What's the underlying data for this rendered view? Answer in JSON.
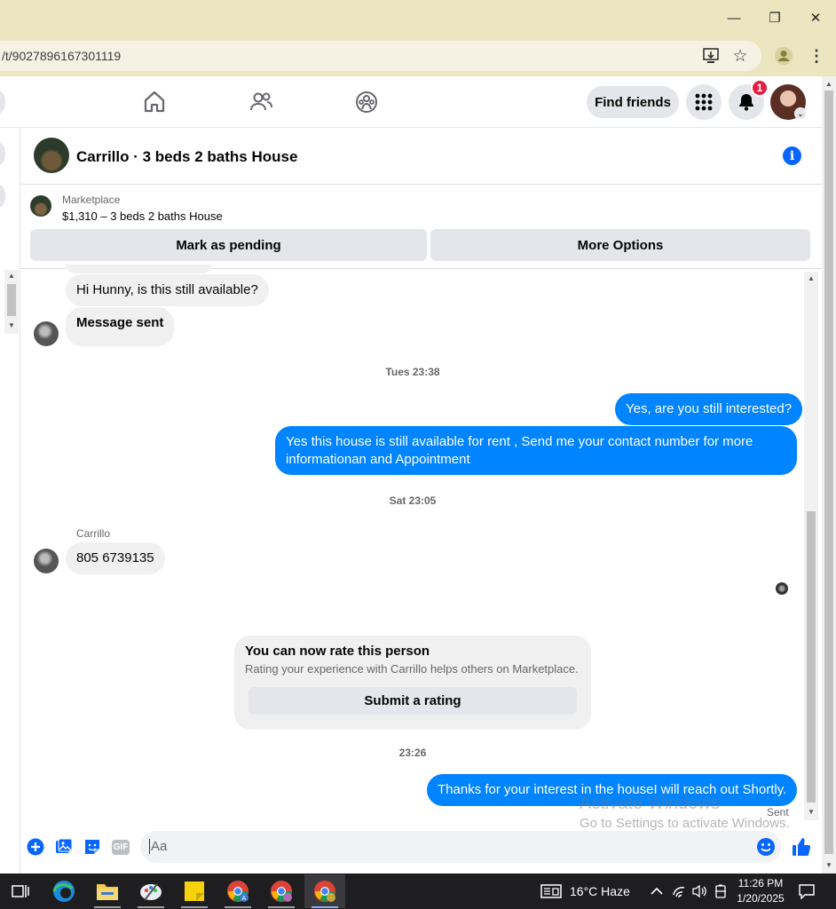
{
  "browser": {
    "url": "/t/9027896167301119",
    "minimize": "—",
    "restore": "❐",
    "close": "✕"
  },
  "header": {
    "find_friends": "Find friends",
    "notification_count": "1"
  },
  "chat": {
    "title": "Carrillo · 3 beds 2 baths House",
    "info": "i",
    "marketplace_label": "Marketplace",
    "listing": "$1,310 – 3 beds 2 baths House",
    "mark_pending": "Mark as pending",
    "more_options": "More Options"
  },
  "messages": {
    "m1": "Hi Hunny, is this still available?",
    "m2": "Message sent",
    "ts1": "Tues 23:38",
    "m3": "Yes, are you still interested?",
    "m4": "Yes this house is still available for rent , Send me your contact number for more informationan and Appointment",
    "ts2": "Sat 23:05",
    "sender": "Carrillo",
    "m5": "805 6739135",
    "ts3": "23:26",
    "m6": "Thanks for your interest in the houseI will reach out Shortly.",
    "status": "Sent"
  },
  "rating": {
    "title": "You can now rate this person",
    "subtitle": "Rating your experience with Carrillo helps others on Marketplace.",
    "button": "Submit a rating"
  },
  "composer": {
    "placeholder": "Aa",
    "gif": "GIF"
  },
  "watermark": {
    "line1": "Activate Windows",
    "line2": "Go to Settings to activate Windows."
  },
  "taskbar": {
    "weather": "16°C  Haze",
    "time": "11:26 PM",
    "date": "1/20/2025"
  },
  "colors": {
    "accent": "#0866ff",
    "outgoing_bubble": "#0084ff",
    "incoming_bubble": "#f0f0f0",
    "browser_frame": "#ebe6c0"
  }
}
